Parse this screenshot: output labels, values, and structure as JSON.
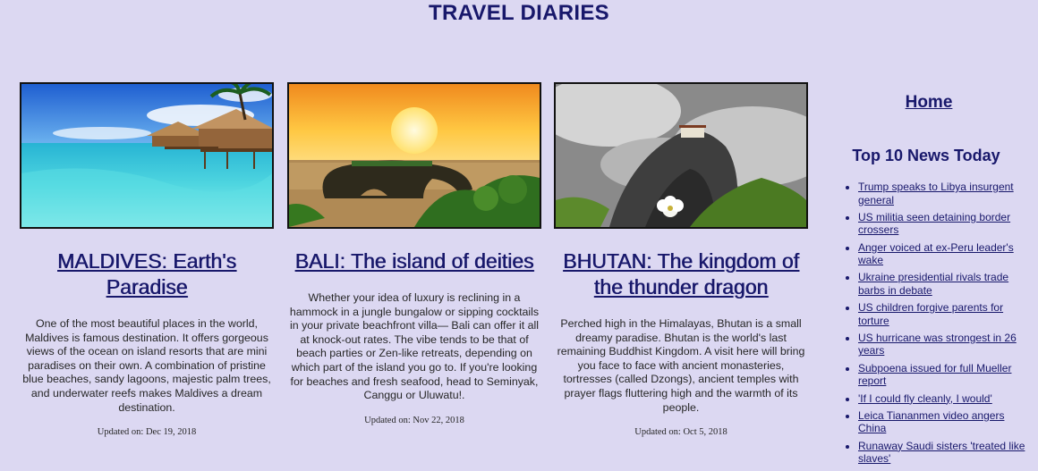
{
  "header": {
    "title": "TRAVEL DIARIES"
  },
  "articles": [
    {
      "title": "MALDIVES: Earth's Paradise",
      "description": "One of the most beautiful places in the world, Maldives is famous destination. It offers gorgeous views of the ocean on island resorts that are mini paradises on their own. A combination of pristine blue beaches, sandy lagoons, majestic palm trees, and underwater reefs makes Maldives a dream destination.",
      "updated": "Updated on: Dec 19, 2018",
      "image": "maldives-overwater-bungalows"
    },
    {
      "title": "BALI: The island of deities",
      "description": "Whether your idea of luxury is reclining in a hammock in a jungle bungalow or sipping cocktails in your private beachfront villa— Bali can offer it all at knock-out rates. The vibe tends to be that of beach parties or Zen-like retreats, depending on which part of the island you go to. If you're looking for beaches and fresh seafood, head to Seminyak, Canggu or Uluwatu!.",
      "updated": "Updated on: Nov 22, 2018",
      "image": "bali-sunset-rock-arch"
    },
    {
      "title": "BHUTAN: The kingdom of the thunder dragon",
      "description": "Perched high in the Himalayas, Bhutan is a small dreamy paradise. Bhutan is the world's last remaining Buddhist Kingdom. A visit here will bring you face to face with ancient monasteries, tortresses (called Dzongs), ancient temples with prayer flags fluttering high and the warmth of its people.",
      "updated": "Updated on: Oct 5, 2018",
      "image": "bhutan-cliff-monastery"
    }
  ],
  "sidebar": {
    "home_label": "Home",
    "news_heading": "Top 10 News Today",
    "news": [
      "Trump speaks to Libya insurgent general",
      "US militia seen detaining border crossers",
      "Anger voiced at ex-Peru leader's wake",
      "Ukraine presidential rivals trade barbs in debate",
      "US children forgive parents for torture",
      "US hurricane was strongest in 26 years",
      "Subpoena issued for full Mueller report",
      "'If I could fly cleanly, I would'",
      "Leica Tiananmen video angers China",
      "Runaway Saudi sisters 'treated like slaves'"
    ]
  },
  "colors": {
    "background": "#dcd8f2",
    "heading": "#18186b",
    "body_text": "#262626"
  }
}
